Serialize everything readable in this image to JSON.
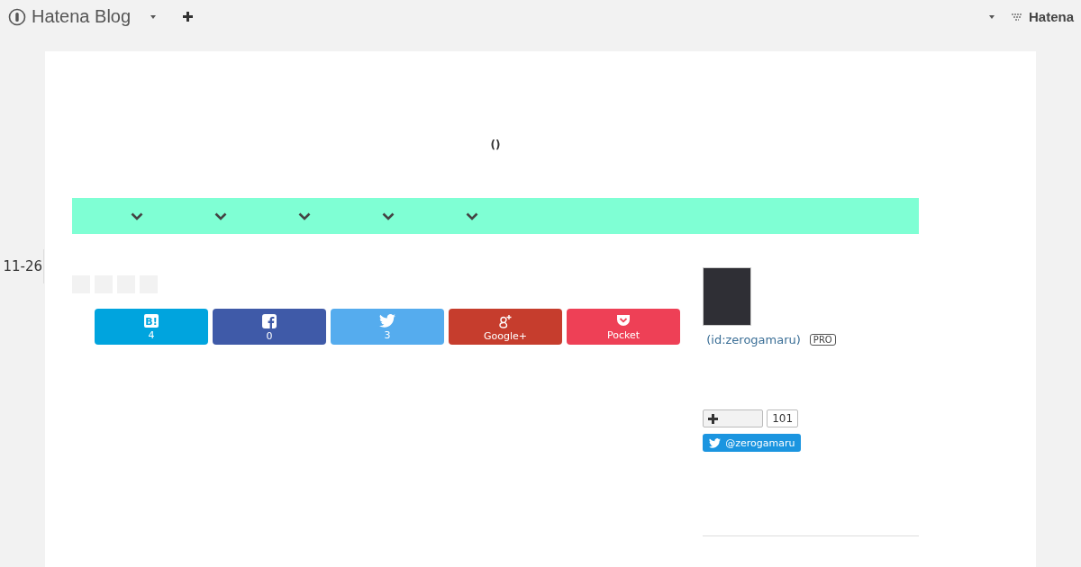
{
  "topbar": {
    "brand": "Hatena Blog",
    "right_brand": "Hatena"
  },
  "blog": {
    "title": "()"
  },
  "nav": {
    "items": [
      {
        "expanded": false
      },
      {
        "expanded": false
      },
      {
        "expanded": false
      },
      {
        "expanded": false
      },
      {
        "expanded": false
      }
    ]
  },
  "entry": {
    "date": "11-26",
    "share_buttons": [
      {
        "kind": "hatena",
        "icon_text": "B!",
        "label": "4"
      },
      {
        "kind": "facebook",
        "label": "0"
      },
      {
        "kind": "twitter",
        "label": "3"
      },
      {
        "kind": "googleplus",
        "label": "Google+"
      },
      {
        "kind": "pocket",
        "label": "Pocket"
      }
    ]
  },
  "sidebar": {
    "profile_id": "(id:zerogamaru)",
    "badge": "PRO",
    "follow_count": "101",
    "twitter_handle": "@zerogamaru"
  }
}
